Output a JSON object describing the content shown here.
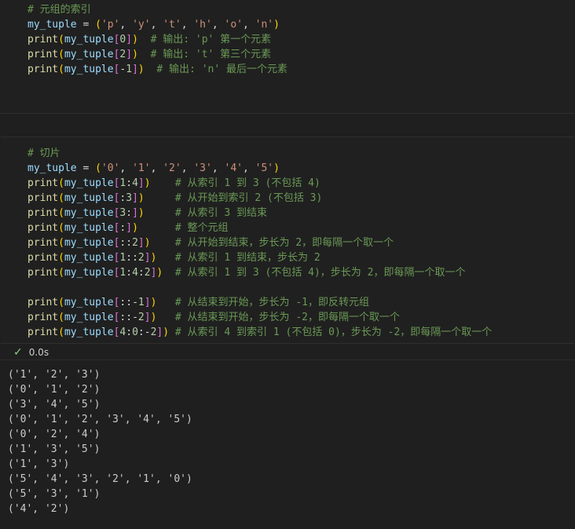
{
  "cell1": {
    "lines": [
      [
        [
          "cm",
          "# 元组的索引"
        ]
      ],
      [
        [
          "var",
          "my_tuple"
        ],
        [
          "op",
          " = "
        ],
        [
          "p1",
          "("
        ],
        [
          "str",
          "'p'"
        ],
        [
          "op",
          ", "
        ],
        [
          "str",
          "'y'"
        ],
        [
          "op",
          ", "
        ],
        [
          "str",
          "'t'"
        ],
        [
          "op",
          ", "
        ],
        [
          "str",
          "'h'"
        ],
        [
          "op",
          ", "
        ],
        [
          "str",
          "'o'"
        ],
        [
          "op",
          ", "
        ],
        [
          "str",
          "'n'"
        ],
        [
          "p1",
          ")"
        ]
      ],
      [
        [
          "fn",
          "print"
        ],
        [
          "p1",
          "("
        ],
        [
          "var",
          "my_tuple"
        ],
        [
          "p2",
          "["
        ],
        [
          "num",
          "0"
        ],
        [
          "p2",
          "]"
        ],
        [
          "p1",
          ")"
        ],
        [
          "op",
          "  "
        ],
        [
          "cm",
          "# 输出: 'p' 第一个元素"
        ]
      ],
      [
        [
          "fn",
          "print"
        ],
        [
          "p1",
          "("
        ],
        [
          "var",
          "my_tuple"
        ],
        [
          "p2",
          "["
        ],
        [
          "num",
          "2"
        ],
        [
          "p2",
          "]"
        ],
        [
          "p1",
          ")"
        ],
        [
          "op",
          "  "
        ],
        [
          "cm",
          "# 输出: 't' 第三个元素"
        ]
      ],
      [
        [
          "fn",
          "print"
        ],
        [
          "p1",
          "("
        ],
        [
          "var",
          "my_tuple"
        ],
        [
          "p2",
          "["
        ],
        [
          "op",
          "-"
        ],
        [
          "num",
          "1"
        ],
        [
          "p2",
          "]"
        ],
        [
          "p1",
          ")"
        ],
        [
          "op",
          "  "
        ],
        [
          "cm",
          "# 输出: 'n' 最后一个元素"
        ]
      ]
    ]
  },
  "cell2": {
    "lines": [
      [
        [
          "cm",
          "# 切片"
        ]
      ],
      [
        [
          "var",
          "my_tuple"
        ],
        [
          "op",
          " = "
        ],
        [
          "p1",
          "("
        ],
        [
          "str",
          "'0'"
        ],
        [
          "op",
          ", "
        ],
        [
          "str",
          "'1'"
        ],
        [
          "op",
          ", "
        ],
        [
          "str",
          "'2'"
        ],
        [
          "op",
          ", "
        ],
        [
          "str",
          "'3'"
        ],
        [
          "op",
          ", "
        ],
        [
          "str",
          "'4'"
        ],
        [
          "op",
          ", "
        ],
        [
          "str",
          "'5'"
        ],
        [
          "p1",
          ")"
        ]
      ],
      [
        [
          "fn",
          "print"
        ],
        [
          "p1",
          "("
        ],
        [
          "var",
          "my_tuple"
        ],
        [
          "p2",
          "["
        ],
        [
          "num",
          "1"
        ],
        [
          "op",
          ":"
        ],
        [
          "num",
          "4"
        ],
        [
          "p2",
          "]"
        ],
        [
          "p1",
          ")"
        ],
        [
          "op",
          "    "
        ],
        [
          "cm",
          "# 从索引 1 到 3 (不包括 4)"
        ]
      ],
      [
        [
          "fn",
          "print"
        ],
        [
          "p1",
          "("
        ],
        [
          "var",
          "my_tuple"
        ],
        [
          "p2",
          "["
        ],
        [
          "op",
          ":"
        ],
        [
          "num",
          "3"
        ],
        [
          "p2",
          "]"
        ],
        [
          "p1",
          ")"
        ],
        [
          "op",
          "     "
        ],
        [
          "cm",
          "# 从开始到索引 2 (不包括 3)"
        ]
      ],
      [
        [
          "fn",
          "print"
        ],
        [
          "p1",
          "("
        ],
        [
          "var",
          "my_tuple"
        ],
        [
          "p2",
          "["
        ],
        [
          "num",
          "3"
        ],
        [
          "op",
          ":"
        ],
        [
          "p2",
          "]"
        ],
        [
          "p1",
          ")"
        ],
        [
          "op",
          "     "
        ],
        [
          "cm",
          "# 从索引 3 到结束"
        ]
      ],
      [
        [
          "fn",
          "print"
        ],
        [
          "p1",
          "("
        ],
        [
          "var",
          "my_tuple"
        ],
        [
          "p2",
          "["
        ],
        [
          "op",
          ":"
        ],
        [
          "p2",
          "]"
        ],
        [
          "p1",
          ")"
        ],
        [
          "op",
          "      "
        ],
        [
          "cm",
          "# 整个元组"
        ]
      ],
      [
        [
          "fn",
          "print"
        ],
        [
          "p1",
          "("
        ],
        [
          "var",
          "my_tuple"
        ],
        [
          "p2",
          "["
        ],
        [
          "op",
          "::"
        ],
        [
          "num",
          "2"
        ],
        [
          "p2",
          "]"
        ],
        [
          "p1",
          ")"
        ],
        [
          "op",
          "    "
        ],
        [
          "cm",
          "# 从开始到结束，步长为 2，即每隔一个取一个"
        ]
      ],
      [
        [
          "fn",
          "print"
        ],
        [
          "p1",
          "("
        ],
        [
          "var",
          "my_tuple"
        ],
        [
          "p2",
          "["
        ],
        [
          "num",
          "1"
        ],
        [
          "op",
          "::"
        ],
        [
          "num",
          "2"
        ],
        [
          "p2",
          "]"
        ],
        [
          "p1",
          ")"
        ],
        [
          "op",
          "   "
        ],
        [
          "cm",
          "# 从索引 1 到结束，步长为 2"
        ]
      ],
      [
        [
          "fn",
          "print"
        ],
        [
          "p1",
          "("
        ],
        [
          "var",
          "my_tuple"
        ],
        [
          "p2",
          "["
        ],
        [
          "num",
          "1"
        ],
        [
          "op",
          ":"
        ],
        [
          "num",
          "4"
        ],
        [
          "op",
          ":"
        ],
        [
          "num",
          "2"
        ],
        [
          "p2",
          "]"
        ],
        [
          "p1",
          ")"
        ],
        [
          "op",
          "  "
        ],
        [
          "cm",
          "# 从索引 1 到 3 (不包括 4)，步长为 2，即每隔一个取一个"
        ]
      ],
      [],
      [
        [
          "fn",
          "print"
        ],
        [
          "p1",
          "("
        ],
        [
          "var",
          "my_tuple"
        ],
        [
          "p2",
          "["
        ],
        [
          "op",
          "::-"
        ],
        [
          "num",
          "1"
        ],
        [
          "p2",
          "]"
        ],
        [
          "p1",
          ")"
        ],
        [
          "op",
          "   "
        ],
        [
          "cm",
          "# 从结束到开始，步长为 -1，即反转元组"
        ]
      ],
      [
        [
          "fn",
          "print"
        ],
        [
          "p1",
          "("
        ],
        [
          "var",
          "my_tuple"
        ],
        [
          "p2",
          "["
        ],
        [
          "op",
          "::-"
        ],
        [
          "num",
          "2"
        ],
        [
          "p2",
          "]"
        ],
        [
          "p1",
          ")"
        ],
        [
          "op",
          "   "
        ],
        [
          "cm",
          "# 从结束到开始，步长为 -2，即每隔一个取一个"
        ]
      ],
      [
        [
          "fn",
          "print"
        ],
        [
          "p1",
          "("
        ],
        [
          "var",
          "my_tuple"
        ],
        [
          "p2",
          "["
        ],
        [
          "num",
          "4"
        ],
        [
          "op",
          ":"
        ],
        [
          "num",
          "0"
        ],
        [
          "op",
          ":-"
        ],
        [
          "num",
          "2"
        ],
        [
          "p2",
          "]"
        ],
        [
          "p1",
          ")"
        ],
        [
          "op",
          " "
        ],
        [
          "cm",
          "# 从索引 4 到索引 1 (不包括 0)，步长为 -2，即每隔一个取一个"
        ]
      ]
    ],
    "status": {
      "time": "0.0s"
    },
    "output": [
      "('1', '2', '3')",
      "('0', '1', '2')",
      "('3', '4', '5')",
      "('0', '1', '2', '3', '4', '5')",
      "('0', '2', '4')",
      "('1', '3', '5')",
      "('1', '3')",
      "('5', '4', '3', '2', '1', '0')",
      "('5', '3', '1')",
      "('4', '2')"
    ]
  }
}
